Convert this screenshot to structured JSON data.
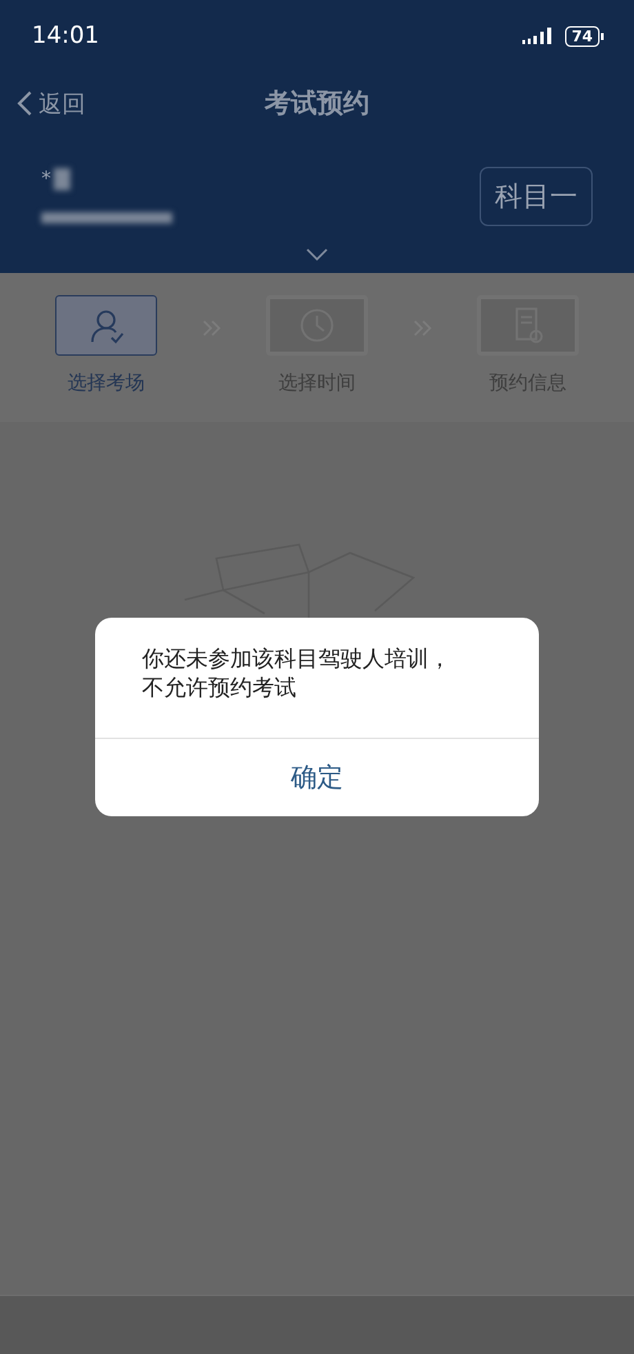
{
  "status_bar": {
    "time": "14:01",
    "battery": "74"
  },
  "nav": {
    "back_label": "返回",
    "title": "考试预约"
  },
  "applicant": {
    "name": "*",
    "subject": "科目一"
  },
  "steps": [
    {
      "label": "选择考场",
      "selected": true,
      "kind": "person"
    },
    {
      "label": "选择时间",
      "selected": false,
      "kind": "clock"
    },
    {
      "label": "预约信息",
      "selected": false,
      "kind": "document"
    }
  ],
  "dialog": {
    "message": "你还未参加该科目驾驶人培训，不允许预约考试",
    "button": "确定"
  }
}
